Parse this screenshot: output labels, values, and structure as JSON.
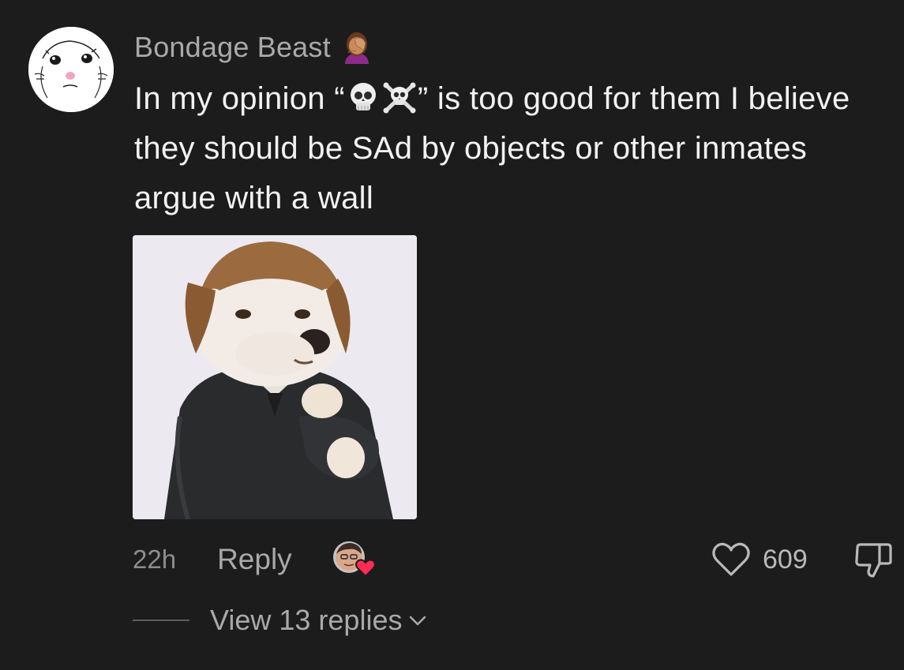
{
  "comment": {
    "username": "Bondage Beast",
    "username_emoji": "facepalm-emoji",
    "text": {
      "part1": "In my opinion “",
      "emoji_1": "skull-emoji",
      "emoji_2": "skull-crossbones-emoji",
      "part2": "” is too good for them I believe they should be SAd by objects or other inmates argue with a wall"
    },
    "attachment": "gif-dog-in-suit",
    "timestamp": "22h",
    "reply_label": "Reply",
    "like_count": "609",
    "view_replies_label": "View 13 replies"
  },
  "colors": {
    "background": "#1c1c1d",
    "text_primary": "#f2f2f2",
    "text_secondary": "#a9a9ab",
    "creator_heart": "#fe2c55"
  },
  "icons": {
    "like": "heart-outline-icon",
    "dislike": "thumbs-down-outline-icon",
    "expand": "chevron-down-icon",
    "creator_liked": "creator-liked-heart-icon"
  }
}
